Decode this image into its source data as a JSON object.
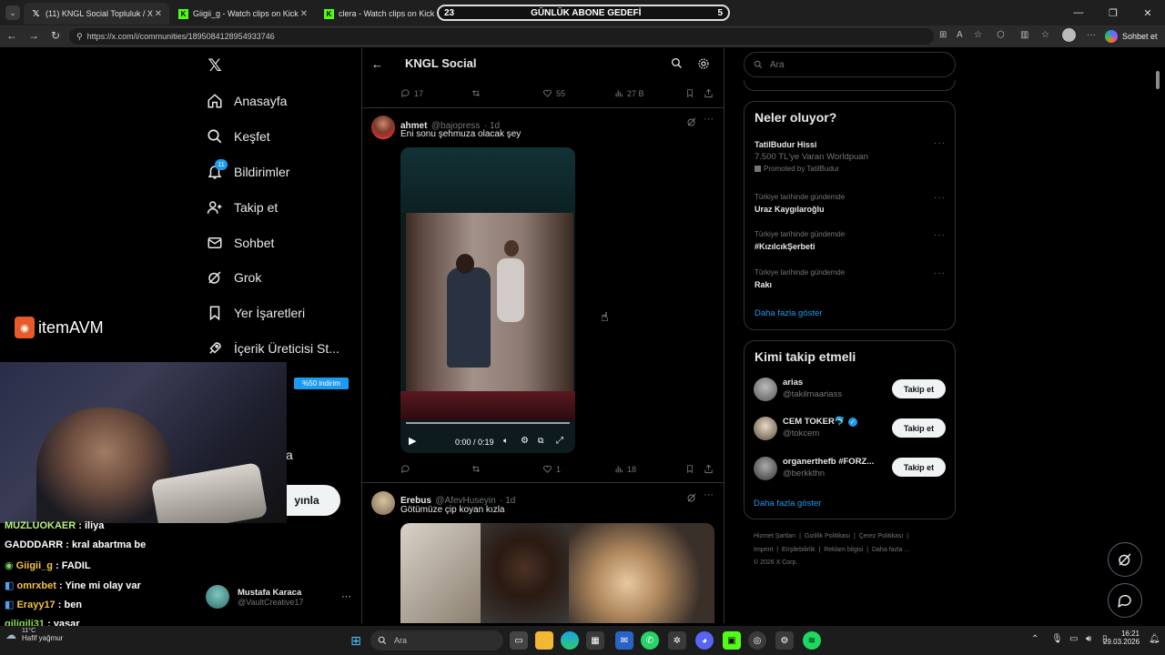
{
  "browser": {
    "tabs": [
      {
        "title": "(11) KNGL Social Topluluk / X",
        "icon": "x-icon"
      },
      {
        "title": "Giigii_g - Watch clips on Kick",
        "icon": "kick-icon"
      },
      {
        "title": "clera - Watch clips on Kick",
        "icon": "kick-icon"
      }
    ],
    "url": "https://x.com/i/communities/1895084128954933746",
    "copilot_label": "Sohbet et"
  },
  "goal_bar": {
    "left": "23",
    "title": "GÜNLÜK ABONE GEDEFİ",
    "right": "5"
  },
  "nav": {
    "items": [
      {
        "label": "Anasayfa",
        "icon": "home-icon"
      },
      {
        "label": "Keşfet",
        "icon": "search-icon"
      },
      {
        "label": "Bildirimler",
        "icon": "bell-icon",
        "badge": "11"
      },
      {
        "label": "Takip et",
        "icon": "follow-icon"
      },
      {
        "label": "Sohbet",
        "icon": "mail-icon"
      },
      {
        "label": "Grok",
        "icon": "grok-icon"
      },
      {
        "label": "Yer İşaretleri",
        "icon": "bookmark-icon"
      },
      {
        "label": "İçerik Üreticisi St...",
        "icon": "rocket-icon"
      }
    ],
    "partial_label": "a",
    "post_button_partial": "yınla",
    "account": {
      "name": "Mustafa Karaca",
      "handle": "@VaultCreative17"
    }
  },
  "timeline": {
    "title": "KNGL Social",
    "top_actions": {
      "replies": "17",
      "likes": "55",
      "views": "27 B"
    },
    "posts": [
      {
        "name": "ahmet",
        "handle": "@bajopress",
        "time": "· 1d",
        "text": "Eni sonu şehmuza olacak şey",
        "video_time": "0:00 / 0:19",
        "likes": "1",
        "views": "18"
      },
      {
        "name": "Erebus",
        "handle": "@AfevHuseyin",
        "time": "· 1d",
        "text": "Götümüze çip koyan kızla"
      }
    ]
  },
  "search": {
    "placeholder": "Ara"
  },
  "trends": {
    "title": "Neler oluyor?",
    "promoted": {
      "name": "TatilBudur Hissi",
      "desc": "7.500 TL'ye Varan Worldpuan",
      "label": "Promoted by TatilBudur"
    },
    "items": [
      {
        "category": "Türkiye tarihinde gündemde",
        "name": "Uraz Kaygılaroğlu"
      },
      {
        "category": "Türkiye tarihinde gündemde",
        "name": "#KızılcıkŞerbeti"
      },
      {
        "category": "Türkiye tarihinde gündemde",
        "name": "Rakı"
      }
    ],
    "show_more": "Daha fazla göster"
  },
  "who_to_follow": {
    "title": "Kimi takip etmeli",
    "users": [
      {
        "name": "arias",
        "handle": "@takilmaariass"
      },
      {
        "name": "CEM TOKER🐬",
        "handle": "@tokcem",
        "verified": true
      },
      {
        "name": "organerthefb #FORZ...",
        "handle": "@berkkthn"
      }
    ],
    "follow_label": "Takip et",
    "show_more": "Daha fazla göster"
  },
  "footer": {
    "row1": [
      "Hizmet Şartları",
      "Gizlilik Politikası",
      "Çerez Politikası"
    ],
    "row2": [
      "Imprint",
      "Erişilebilirlik",
      "Reklam bilgisi",
      "Daha fazla ..."
    ],
    "copyright": "© 2026 X Corp."
  },
  "stream": {
    "sponsor": "itemAVM",
    "discount_badge": "%50 indirim",
    "chat": [
      {
        "user": "MUZLUOKAER",
        "msg": ": iliya",
        "color": "#b7f37a"
      },
      {
        "user": "GADDDARR",
        "msg": ": kral abartma be",
        "color": "#ffffff"
      },
      {
        "user": "Giigii_g",
        "msg": ": FADIL",
        "color": "#7ad36b"
      },
      {
        "user": "omrxbet",
        "msg": ": Yine mi olay var",
        "color": "#f6c244"
      },
      {
        "user": "Erayy17",
        "msg": ": ben",
        "color": "#f6c244"
      },
      {
        "user": "giligili31",
        "msg": ": yaşar",
        "color": "#8be04e"
      }
    ]
  },
  "taskbar": {
    "weather_temp": "11°C",
    "weather_desc": "Hafif yağmur",
    "search_placeholder": "Ara",
    "time": "16:21",
    "date": "29.03.2026"
  }
}
